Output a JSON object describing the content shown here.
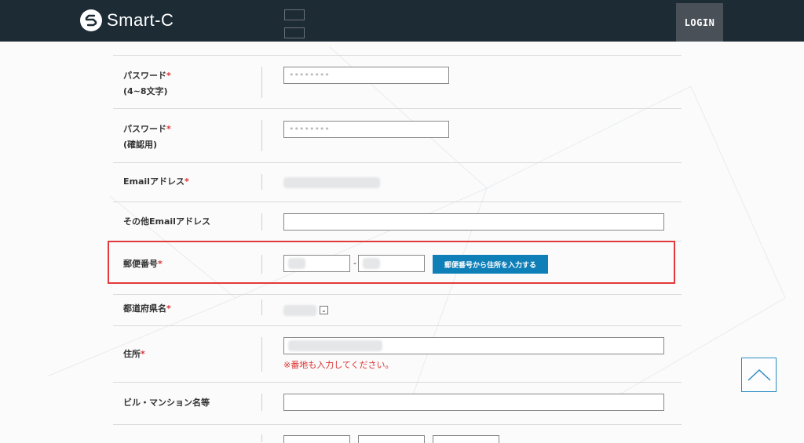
{
  "header": {
    "logo_text": "Smart-C",
    "login_label": "LOGIN"
  },
  "form": {
    "password": {
      "label": "パスワード",
      "sub": "(4~8文字)",
      "required_mark": "*",
      "placeholder": "••••••••"
    },
    "password_confirm": {
      "label": "パスワード",
      "sub": "(確認用)",
      "required_mark": "*",
      "placeholder": "••••••••"
    },
    "email": {
      "label": "Emailアドレス",
      "required_mark": "*"
    },
    "other_email": {
      "label": "その他Emailアドレス"
    },
    "zip": {
      "label": "郵便番号",
      "required_mark": "*",
      "separator": "-",
      "lookup_button": "郵便番号から住所を入力する"
    },
    "prefecture": {
      "label": "都道府県名",
      "required_mark": "*",
      "caret": "⌄"
    },
    "address": {
      "label": "住所",
      "required_mark": "*",
      "note": "※番地も入力してください。"
    },
    "building": {
      "label": "ビル・マンション名等"
    }
  },
  "colors": {
    "header_bg": "#1d2b35",
    "accent": "#0f7fb8",
    "required": "#d33333",
    "highlight": "#e23a3a"
  },
  "icons": {
    "logo": "logo-s-icon",
    "scroll_top": "chevron-up-icon"
  }
}
